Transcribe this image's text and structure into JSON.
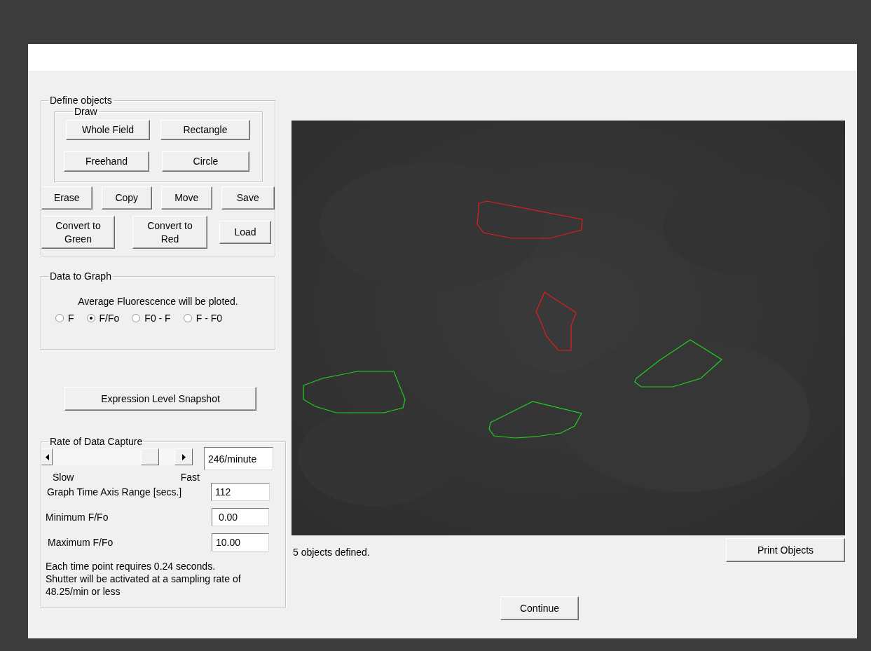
{
  "define_objects": {
    "title": "Define objects",
    "draw": {
      "title": "Draw",
      "buttons": [
        "Whole Field",
        "Rectangle",
        "Freehand",
        "Circle"
      ]
    },
    "edit_buttons": [
      "Erase",
      "Copy",
      "Move",
      "Save"
    ],
    "convert_buttons": [
      "Convert to Green",
      "Convert to Red",
      "Load"
    ]
  },
  "data_to_graph": {
    "title": "Data to Graph",
    "caption": "Average Fluorescence  will be ploted.",
    "options": [
      {
        "label": "F",
        "selected": false
      },
      {
        "label": "F/Fo",
        "selected": true
      },
      {
        "label": "F0 - F",
        "selected": false
      },
      {
        "label": "F - F0",
        "selected": false
      }
    ]
  },
  "snapshot_button": "Expression Level Snapshot",
  "rate": {
    "title": "Rate of Data Capture",
    "level": 0.85,
    "value": "246/minute",
    "slow": "Slow",
    "fast": "Fast",
    "fields": [
      {
        "label": "Graph Time Axis Range [secs.]",
        "value": "112"
      },
      {
        "label": "Minimum F/Fo",
        "value": " 0.00"
      },
      {
        "label": "Maximum F/Fo",
        "value": "10.00"
      }
    ],
    "note": "Each time point requires 0.24 seconds.\nShutter will be activated at a sampling rate of\n48.25/min or less"
  },
  "image": {
    "objects": [
      {
        "color": "#e01e1e"
      },
      {
        "color": "#e01e1e"
      },
      {
        "color": "#1ed21e"
      },
      {
        "color": "#1ed21e"
      },
      {
        "color": "#1ed21e"
      }
    ]
  },
  "status": "5 objects defined.",
  "print_button": "Print Objects",
  "continue_button": "Continue"
}
